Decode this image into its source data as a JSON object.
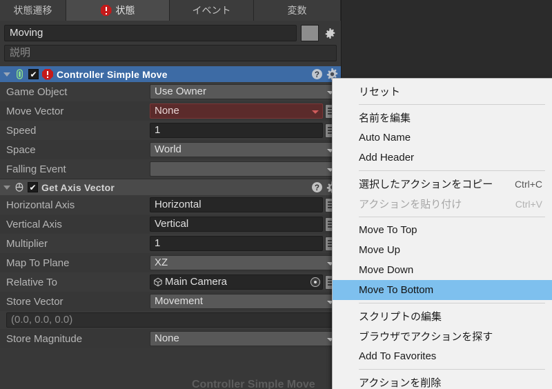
{
  "tabs": [
    {
      "label": "状態遷移",
      "icon": null,
      "active": false,
      "width": "w1"
    },
    {
      "label": "状態",
      "icon": "error-octagon-icon",
      "active": true,
      "width": "w2"
    },
    {
      "label": "イベント",
      "icon": null,
      "active": false,
      "width": "w3"
    },
    {
      "label": "変数",
      "icon": null,
      "active": false,
      "width": "w4"
    }
  ],
  "state": {
    "name_value": "Moving",
    "description_placeholder": "説明",
    "color_swatch": "#8d8d8d",
    "gear_icon": "gear-icon"
  },
  "actions": [
    {
      "title": "Controller Simple Move",
      "selected": true,
      "enabled_check": "✔",
      "type_icon": "character-controller-icon",
      "has_error_icon": true,
      "help_icon": "help-icon",
      "gear_icon": "gear-icon",
      "fields": [
        {
          "label": "Game Object",
          "kind": "popup",
          "value": "Use Owner",
          "binder": false
        },
        {
          "label": "Move Vector",
          "kind": "error",
          "value": "None",
          "binder": true
        },
        {
          "label": "Speed",
          "kind": "input",
          "value": "1",
          "binder": true
        },
        {
          "label": "Space",
          "kind": "popup",
          "value": "World",
          "binder": false
        },
        {
          "label": "Falling Event",
          "kind": "popup",
          "value": "",
          "binder": false
        }
      ]
    },
    {
      "title": "Get Axis Vector",
      "selected": false,
      "enabled_check": "✔",
      "type_icon": "mouse-input-icon",
      "has_error_icon": false,
      "help_icon": "help-icon",
      "gear_icon": "gear-icon",
      "fields": [
        {
          "label": "Horizontal Axis",
          "kind": "input",
          "value": "Horizontal",
          "binder": true
        },
        {
          "label": "Vertical Axis",
          "kind": "input",
          "value": "Vertical",
          "binder": true
        },
        {
          "label": "Multiplier",
          "kind": "input",
          "value": "1",
          "binder": true
        },
        {
          "label": "Map To Plane",
          "kind": "popup",
          "value": "XZ",
          "binder": false
        },
        {
          "label": "Relative To",
          "kind": "object",
          "value": "Main Camera",
          "binder": true,
          "object_icon": "prefab-cube-icon"
        },
        {
          "label": "Store Vector",
          "kind": "popup",
          "value": "Movement",
          "binder": false
        },
        {
          "label": "",
          "kind": "vector",
          "value": "(0.0, 0.0, 0.0)",
          "binder": false
        },
        {
          "label": "Store Magnitude",
          "kind": "popup",
          "value": "None",
          "binder": false
        }
      ]
    }
  ],
  "ghost_title": "Controller Simple Move",
  "context_menu": {
    "items": [
      {
        "label": "リセット",
        "shortcut": "",
        "type": "item"
      },
      {
        "type": "separator"
      },
      {
        "label": "名前を編集",
        "shortcut": "",
        "type": "item"
      },
      {
        "label": "Auto Name",
        "shortcut": "",
        "type": "item"
      },
      {
        "label": "Add Header",
        "shortcut": "",
        "type": "item"
      },
      {
        "type": "separator"
      },
      {
        "label": "選択したアクションをコピー",
        "shortcut": "Ctrl+C",
        "type": "item"
      },
      {
        "label": "アクションを貼り付け",
        "shortcut": "Ctrl+V",
        "type": "disabled"
      },
      {
        "type": "separator"
      },
      {
        "label": "Move To Top",
        "shortcut": "",
        "type": "item"
      },
      {
        "label": "Move Up",
        "shortcut": "",
        "type": "item"
      },
      {
        "label": "Move Down",
        "shortcut": "",
        "type": "item"
      },
      {
        "label": "Move To Bottom",
        "shortcut": "",
        "type": "highlighted"
      },
      {
        "type": "separator"
      },
      {
        "label": "スクリプトの編集",
        "shortcut": "",
        "type": "item"
      },
      {
        "label": "ブラウザでアクションを探す",
        "shortcut": "",
        "type": "item"
      },
      {
        "label": "Add To Favorites",
        "shortcut": "",
        "type": "item"
      },
      {
        "type": "separator"
      },
      {
        "label": "アクションを削除",
        "shortcut": "",
        "type": "item"
      }
    ],
    "highlight_color": "#7ec0ee"
  }
}
